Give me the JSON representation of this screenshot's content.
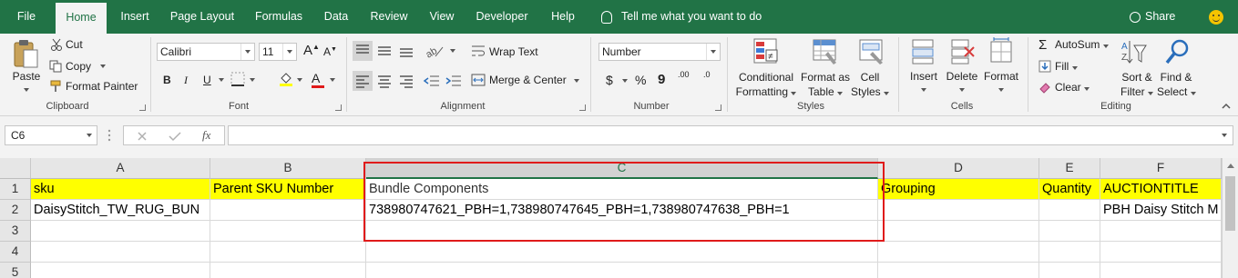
{
  "menu": {
    "tabs": [
      "File",
      "Home",
      "Insert",
      "Page Layout",
      "Formulas",
      "Data",
      "Review",
      "View",
      "Developer",
      "Help"
    ],
    "active": "Home",
    "tell_me": "Tell me what you want to do",
    "share": "Share"
  },
  "ribbon": {
    "clipboard": {
      "label": "Clipboard",
      "paste": "Paste",
      "cut": "Cut",
      "copy": "Copy",
      "format_painter": "Format Painter"
    },
    "font": {
      "label": "Font",
      "name": "Calibri",
      "size": "11",
      "bold": "B",
      "italic": "I",
      "underline": "U",
      "grow": "A",
      "shrink": "A",
      "font_color_letter": "A"
    },
    "alignment": {
      "label": "Alignment",
      "wrap_text": "Wrap Text",
      "merge_center": "Merge & Center"
    },
    "number": {
      "label": "Number",
      "format": "Number",
      "currency": "$",
      "percent": "%",
      "comma": "9",
      "inc_decimal": ".00",
      "dec_decimal": ".0"
    },
    "styles": {
      "label": "Styles",
      "conditional_1": "Conditional",
      "conditional_2": "Formatting",
      "format_as_1": "Format as",
      "format_as_2": "Table",
      "cell_styles_1": "Cell",
      "cell_styles_2": "Styles"
    },
    "cells": {
      "label": "Cells",
      "insert": "Insert",
      "delete": "Delete",
      "format": "Format"
    },
    "editing": {
      "label": "Editing",
      "autosum": "AutoSum",
      "fill": "Fill",
      "clear": "Clear",
      "sort_1": "Sort &",
      "sort_2": "Filter",
      "find_1": "Find &",
      "find_2": "Select"
    }
  },
  "formula_bar": {
    "name_box": "C6",
    "fx": "fx",
    "content": ""
  },
  "sheet": {
    "columns": [
      "A",
      "B",
      "C",
      "D",
      "E",
      "F"
    ],
    "selected_column": "C",
    "rows": [
      "1",
      "2",
      "3",
      "4",
      "5"
    ],
    "cells": {
      "A1": "sku",
      "B1": "Parent SKU Number",
      "C1": "Bundle Components",
      "D1": "Grouping",
      "E1": "Quantity",
      "F1": "AUCTIONTITLE",
      "A2": "DaisyStitch_TW_RUG_BUN",
      "B2": "",
      "C2": "738980747621_PBH=1,738980747645_PBH=1,738980747638_PBH=1",
      "D2": "",
      "E2": "",
      "F2": "PBH Daisy Stitch M"
    }
  },
  "colors": {
    "excel_green": "#217346",
    "header_fill": "#ffff00",
    "highlight": "#e01b1b"
  }
}
